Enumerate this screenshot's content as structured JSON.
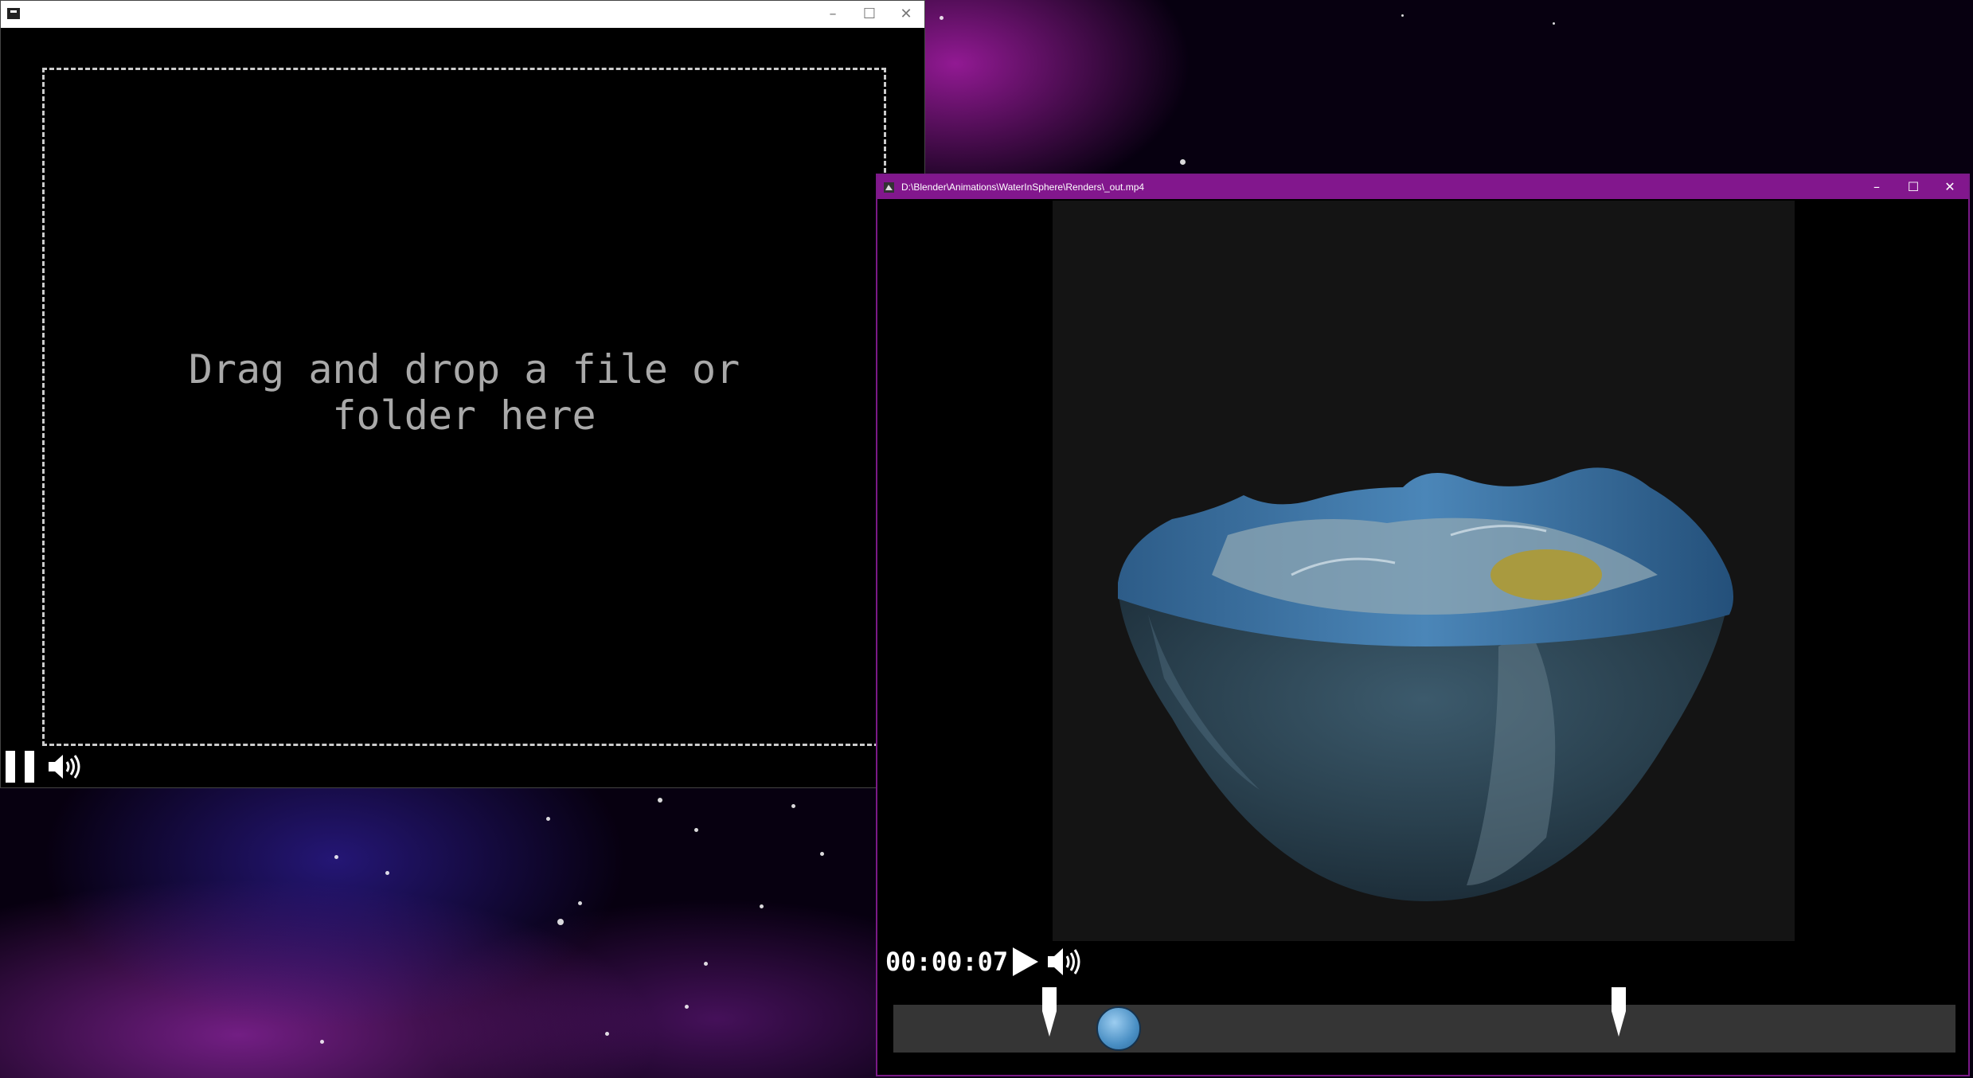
{
  "left_window": {
    "title": "",
    "controls": {
      "minimize": "–",
      "maximize": "☐",
      "close": "✕"
    },
    "drop_prompt": "Drag and drop a file or folder here",
    "playback_state": "paused"
  },
  "right_window": {
    "title": "D:\\Blender\\Animations\\WaterInSphere\\Renders\\_out.mp4",
    "controls": {
      "minimize": "–",
      "maximize": "☐",
      "close": "✕"
    },
    "timecode": "00:00:07",
    "playback_state": "paused",
    "timeline": {
      "in_marker_fraction": 0.147,
      "out_marker_fraction": 0.683,
      "playhead_fraction": 0.212
    }
  },
  "colors": {
    "accent_titlebar": "#82178d",
    "timeline_track": "#353535",
    "playhead": "#4a8fc4",
    "drop_text": "#a9a9a9"
  },
  "icons": [
    "pause-icon",
    "volume-icon",
    "play-icon",
    "in-marker-icon",
    "out-marker-icon"
  ]
}
